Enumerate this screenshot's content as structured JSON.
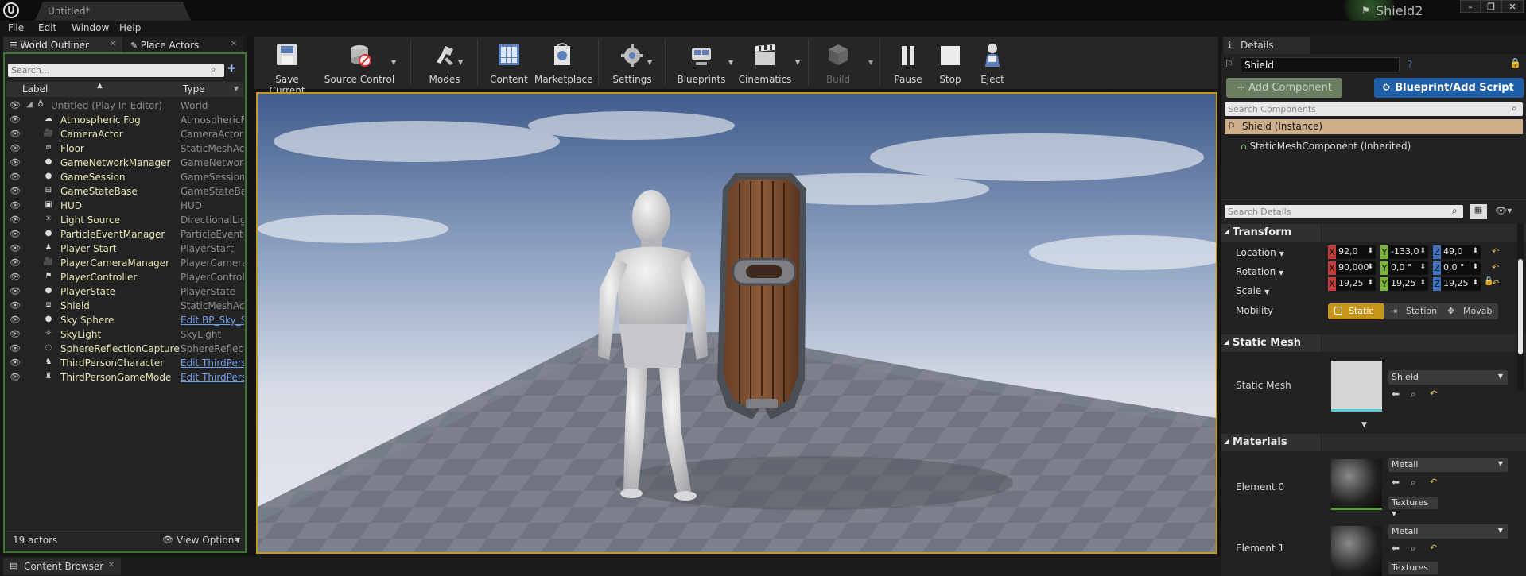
{
  "window": {
    "doc_tab": "Untitled*",
    "project_name": "Shield2",
    "min": "–",
    "max": "❐",
    "close": "✕"
  },
  "menu": [
    "File",
    "Edit",
    "Window",
    "Help"
  ],
  "left_tabs": {
    "outliner": "World Outliner",
    "place": "Place Actors"
  },
  "outliner": {
    "search_placeholder": "Search...",
    "col_label": "Label",
    "col_type": "Type",
    "root": {
      "label": "Untitled (Play In Editor)",
      "type": "World"
    },
    "rows": [
      {
        "label": "Atmospheric Fog",
        "type": "AtmosphericFog",
        "link": false,
        "icon": "fog-icon"
      },
      {
        "label": "CameraActor",
        "type": "CameraActor",
        "link": false,
        "icon": "camera-icon"
      },
      {
        "label": "Floor",
        "type": "StaticMeshActor",
        "link": false,
        "icon": "mesh-icon"
      },
      {
        "label": "GameNetworkManager",
        "type": "GameNetworkManager",
        "link": false,
        "icon": "actor-icon"
      },
      {
        "label": "GameSession",
        "type": "GameSession",
        "link": false,
        "icon": "actor-icon"
      },
      {
        "label": "GameStateBase",
        "type": "GameStateBase",
        "link": false,
        "icon": "info-icon"
      },
      {
        "label": "HUD",
        "type": "HUD",
        "link": false,
        "icon": "hud-icon"
      },
      {
        "label": "Light Source",
        "type": "DirectionalLight",
        "link": false,
        "icon": "light-icon"
      },
      {
        "label": "ParticleEventManager",
        "type": "ParticleEventManager",
        "link": false,
        "icon": "actor-icon"
      },
      {
        "label": "Player Start",
        "type": "PlayerStart",
        "link": false,
        "icon": "playerstart-icon"
      },
      {
        "label": "PlayerCameraManager",
        "type": "PlayerCameraManager",
        "link": false,
        "icon": "camera-icon"
      },
      {
        "label": "PlayerController",
        "type": "PlayerController",
        "link": false,
        "icon": "controller-icon"
      },
      {
        "label": "PlayerState",
        "type": "PlayerState",
        "link": false,
        "icon": "actor-icon"
      },
      {
        "label": "Shield",
        "type": "StaticMeshActor",
        "link": false,
        "icon": "mesh-icon"
      },
      {
        "label": "Sky Sphere",
        "type": "Edit BP_Sky_Sphere",
        "link": true,
        "icon": "actor-icon"
      },
      {
        "label": "SkyLight",
        "type": "SkyLight",
        "link": false,
        "icon": "skylight-icon"
      },
      {
        "label": "SphereReflectionCapture",
        "type": "SphereReflectionCapture",
        "link": false,
        "icon": "reflection-icon"
      },
      {
        "label": "ThirdPersonCharacter",
        "type": "Edit ThirdPersonCharacter",
        "link": true,
        "icon": "character-icon"
      },
      {
        "label": "ThirdPersonGameMode",
        "type": "Edit ThirdPersonGameMode",
        "link": true,
        "icon": "gamemode-icon"
      }
    ],
    "actor_count": "19 actors",
    "view_options": "View Options"
  },
  "toolbar": {
    "save": "Save Current",
    "source_control": "Source Control",
    "modes": "Modes",
    "content": "Content",
    "marketplace": "Marketplace",
    "settings": "Settings",
    "blueprints": "Blueprints",
    "cinematics": "Cinematics",
    "build": "Build",
    "pause": "Pause",
    "stop": "Stop",
    "eject": "Eject"
  },
  "details": {
    "tab": "Details",
    "actor_name": "Shield",
    "add_component": "+ Add Component",
    "blueprint_script": "Blueprint/Add Script",
    "search_components": "Search Components",
    "instance": "Shield (Instance)",
    "component": "StaticMeshComponent (Inherited)",
    "search_details": "Search Details",
    "transform": {
      "title": "Transform",
      "location_label": "Location",
      "rotation_label": "Rotation",
      "scale_label": "Scale",
      "mobility_label": "Mobility",
      "location": [
        "92,0",
        "-133,0",
        "49,0"
      ],
      "rotation": [
        "90,000",
        "0,0 °",
        "0,0 °"
      ],
      "scale": [
        "19,25",
        "19,25",
        "19,25"
      ],
      "mobility": [
        "Static",
        "Station",
        "Movab"
      ]
    },
    "static_mesh": {
      "title": "Static Mesh",
      "label": "Static Mesh",
      "value": "Shield"
    },
    "materials": {
      "title": "Materials",
      "elements": [
        {
          "label": "Element 0",
          "value": "Metall",
          "textures": "Textures"
        },
        {
          "label": "Element 1",
          "value": "Metall",
          "textures": "Textures"
        }
      ]
    }
  },
  "content_browser": "Content Browser",
  "axes": {
    "x": "X",
    "y": "Y",
    "z": "Z"
  },
  "colors": {
    "selection_outline": "#c39a20",
    "outliner_focus": "#3b7a2c",
    "blueprint_btn": "#1f5fa8",
    "add_comp": "#6c7e61",
    "static_btn": "#c7951a",
    "instance_row": "#cdb08b"
  }
}
